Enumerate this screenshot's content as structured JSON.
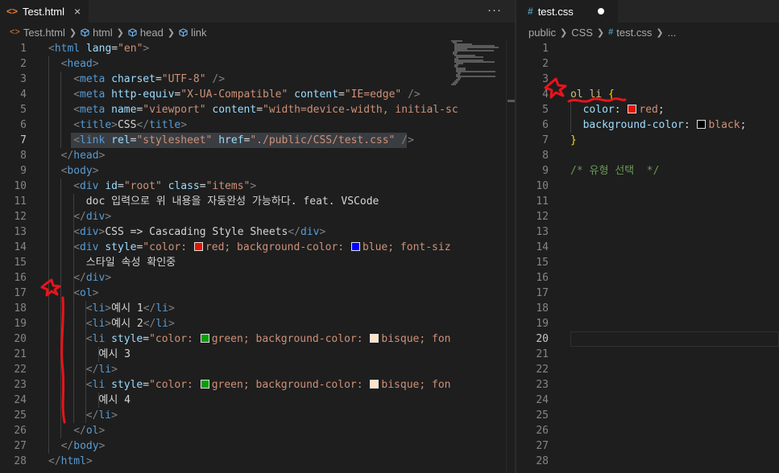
{
  "left_tab": {
    "label": "Test.html",
    "icon": "html-file-icon",
    "close_symbol": "×"
  },
  "more_actions_symbol": "···",
  "left_breadcrumb": [
    "Test.html",
    "html",
    "head",
    "link"
  ],
  "right_tab": {
    "label": "test.css",
    "icon": "css-hash-icon",
    "icon_text": "#",
    "modified_dot": true
  },
  "right_breadcrumb": [
    "public",
    "CSS",
    "test.css",
    "..."
  ],
  "html_lines": [
    {
      "n": "1",
      "text": "<html lang=\"en\">"
    },
    {
      "n": "2",
      "text": "<head>"
    },
    {
      "n": "3",
      "text": "<meta charset=\"UTF-8\" />"
    },
    {
      "n": "4",
      "text": "<meta http-equiv=\"X-UA-Compatible\" content=\"IE=edge\" />"
    },
    {
      "n": "5",
      "text": "<meta name=\"viewport\" content=\"width=device-width, initial-sc"
    },
    {
      "n": "6",
      "text": "<title>CSS</title>"
    },
    {
      "n": "7",
      "text": "<link rel=\"stylesheet\" href=\"./public/CSS/test.css\" />"
    },
    {
      "n": "8",
      "text": "</head>"
    },
    {
      "n": "9",
      "text": "<body>"
    },
    {
      "n": "10",
      "text": "<div id=\"root\" class=\"items\">"
    },
    {
      "n": "11",
      "text": "doc 입력으로 위 내용을 자동완성 가능하다. feat. VSCode"
    },
    {
      "n": "12",
      "text": "</div>"
    },
    {
      "n": "13",
      "text": "<div>CSS => Cascading Style Sheets</div>"
    },
    {
      "n": "14",
      "text": "<div style=\"color: red; background-color: blue; font-siz"
    },
    {
      "n": "15",
      "text": "스타일 속성 확인중"
    },
    {
      "n": "16",
      "text": "</div>"
    },
    {
      "n": "17",
      "text": "<ol>"
    },
    {
      "n": "18",
      "text": "<li>예시 1</li>"
    },
    {
      "n": "19",
      "text": "<li>예시 2</li>"
    },
    {
      "n": "20",
      "text": "<li style=\"color: green; background-color: bisque; fon"
    },
    {
      "n": "21",
      "text": "예시 3"
    },
    {
      "n": "22",
      "text": "</li>"
    },
    {
      "n": "23",
      "text": "<li style=\"color: green; background-color: bisque; fon"
    },
    {
      "n": "24",
      "text": "예시 4"
    },
    {
      "n": "25",
      "text": "</li>"
    },
    {
      "n": "26",
      "text": "</ol>"
    },
    {
      "n": "27",
      "text": "</body>"
    },
    {
      "n": "28",
      "text": "</html>"
    }
  ],
  "html_current_line": "7",
  "css_lines": [
    {
      "n": "1",
      "text": ""
    },
    {
      "n": "2",
      "text": ""
    },
    {
      "n": "3",
      "text": ""
    },
    {
      "n": "4",
      "text": "ol li {"
    },
    {
      "n": "5",
      "text": "color: red;"
    },
    {
      "n": "6",
      "text": "background-color: black;"
    },
    {
      "n": "7",
      "text": "}"
    },
    {
      "n": "8",
      "text": ""
    },
    {
      "n": "9",
      "text": "/* 유형 선택  */"
    },
    {
      "n": "10",
      "text": ""
    },
    {
      "n": "11",
      "text": ""
    },
    {
      "n": "12",
      "text": ""
    },
    {
      "n": "13",
      "text": ""
    },
    {
      "n": "14",
      "text": ""
    },
    {
      "n": "15",
      "text": ""
    },
    {
      "n": "16",
      "text": ""
    },
    {
      "n": "17",
      "text": ""
    },
    {
      "n": "18",
      "text": ""
    },
    {
      "n": "19",
      "text": ""
    },
    {
      "n": "20",
      "text": ""
    },
    {
      "n": "21",
      "text": ""
    },
    {
      "n": "22",
      "text": ""
    },
    {
      "n": "23",
      "text": ""
    },
    {
      "n": "24",
      "text": ""
    },
    {
      "n": "25",
      "text": ""
    },
    {
      "n": "26",
      "text": ""
    },
    {
      "n": "27",
      "text": ""
    },
    {
      "n": "28",
      "text": ""
    }
  ],
  "css_current_line": "20",
  "colors": {
    "red": "#e51400",
    "blue": "#0000ff",
    "green": "#00a000",
    "bisque": "#ffe4c4",
    "black": "#000000",
    "annotation_red": "#e8141c"
  }
}
